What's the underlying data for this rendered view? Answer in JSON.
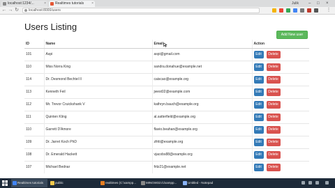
{
  "browser": {
    "tabs": [
      {
        "label": "localhost:1234/..."
      },
      {
        "label": "Realtimes tutorials"
      }
    ],
    "profile": "Julik",
    "address": "localhost:8000/users"
  },
  "main": {
    "title": "Users Listing",
    "add_button": "Add New user",
    "table": {
      "headers": [
        "ID",
        "Name",
        "Email",
        "Action"
      ],
      "rows": [
        [
          "101",
          "Aspi",
          "aspi@gmail.com"
        ],
        [
          "110",
          "Miss Norra King",
          "sandra.donahue@example.net"
        ],
        [
          "114",
          "Dr. Desmond Bechtel II",
          "caiscao@example.org"
        ],
        [
          "113",
          "Kenneth Feil",
          "jwest02@example.com"
        ],
        [
          "112",
          "Mr. Trevor Cruickshank V",
          "kathryn.bauch@example.org"
        ],
        [
          "111",
          "Quinten Kling",
          "al.satterfield@example.org"
        ],
        [
          "110",
          "Garrett D'Amore",
          "flavio.beahan@example.org"
        ],
        [
          "109",
          "Dr. Jarret Koch PhD",
          "zfriti@example.org"
        ],
        [
          "108",
          "Dr. Emerald Hackett",
          "vjacobs88@example.org"
        ],
        [
          "107",
          "Michael Bednar",
          "fritz21@example.net"
        ]
      ],
      "edit_label": "Edit",
      "delete_label": "Delete"
    }
  },
  "taskbar": {
    "items": [
      "Realtimes tutorials",
      "public",
      "realtimes (C:\\xampp...",
      "MINGW32:/c/xampp...",
      "Untitled - Notepad"
    ]
  },
  "colors": {
    "add_button": "#5cb85c",
    "edit_button": "#337ab7",
    "delete_button": "#d9534f",
    "taskbar": "#1d2a39"
  }
}
